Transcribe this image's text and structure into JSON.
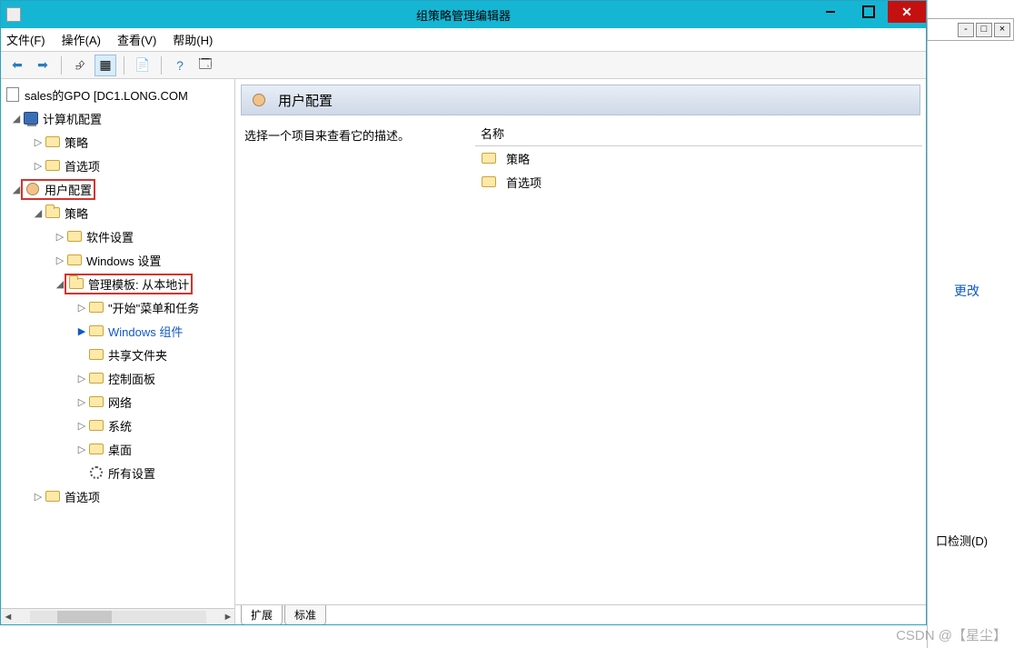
{
  "window": {
    "title": "组策略管理编辑器"
  },
  "menu": {
    "file": "文件(F)",
    "action": "操作(A)",
    "view": "查看(V)",
    "help": "帮助(H)"
  },
  "toolbar_icons": {
    "back": "back-icon",
    "forward": "forward-icon",
    "up": "up-icon",
    "show": "show-icon",
    "refresh": "refresh-icon",
    "export": "export-icon",
    "help": "help-icon",
    "props": "properties-icon"
  },
  "tree": {
    "root": "sales的GPO [DC1.LONG.COM",
    "computer_config": "计算机配置",
    "computer_children": {
      "policy": "策略",
      "preferences": "首选项"
    },
    "user_config": "用户配置",
    "user_policy": "策略",
    "user_policy_children": {
      "software": "软件设置",
      "windows_settings": "Windows 设置",
      "admin_templates": "管理模板: 从本地计",
      "admin_children": {
        "start_menu": "\"开始\"菜单和任务",
        "win_components": "Windows 组件",
        "shared": "共享文件夹",
        "control_panel": "控制面板",
        "network": "网络",
        "system": "系统",
        "desktop": "桌面",
        "all_settings": "所有设置"
      }
    },
    "user_preferences": "首选项"
  },
  "content": {
    "heading": "用户配置",
    "description": "选择一个项目来查看它的描述。",
    "column_name": "名称",
    "items": {
      "policy": "策略",
      "preferences": "首选项"
    }
  },
  "tabs": {
    "extended": "扩展",
    "standard": "标准"
  },
  "bg": {
    "change": "更改",
    "detect": "口检测(D)"
  },
  "watermark": "CSDN @【星尘】"
}
